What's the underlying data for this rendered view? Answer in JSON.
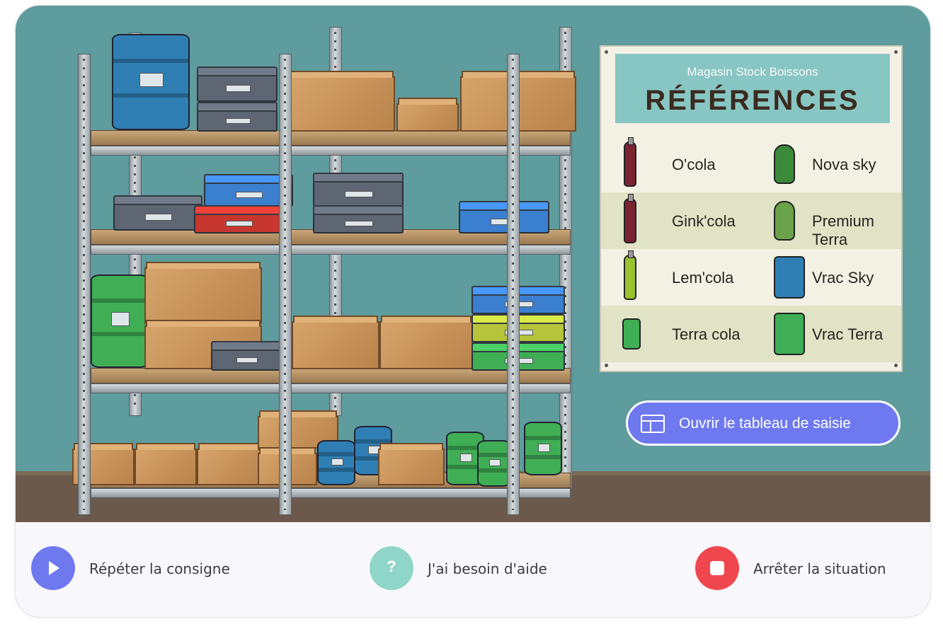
{
  "reference_board": {
    "subtitle": "Magasin Stock Boissons",
    "title": "RÉFÉRENCES",
    "items": [
      {
        "name": "O'cola",
        "icon": "red-bottle-icon"
      },
      {
        "name": "Nova sky",
        "icon": "orange-flask-bottle-icon"
      },
      {
        "name": "Gink'cola",
        "icon": "red-bottle-icon"
      },
      {
        "name": "Premium Terra",
        "icon": "green-flask-bottle-icon"
      },
      {
        "name": "Lem'cola",
        "icon": "yellow-bottle-icon"
      },
      {
        "name": "Vrac Sky",
        "icon": "blue-drum-icon"
      },
      {
        "name": "Terra cola",
        "icon": "green-can-icon"
      },
      {
        "name": "Vrac Terra",
        "icon": "green-drum-icon"
      }
    ]
  },
  "open_table_button": {
    "label": "Ouvrir le tableau de saisie",
    "icon": "table-icon"
  },
  "actions": {
    "repeat": {
      "label": "Répéter la consigne",
      "icon": "play-icon",
      "color": "#6e79f0"
    },
    "help": {
      "label": "J'ai besoin d'aide",
      "icon": "question-icon",
      "color": "#8fd6c8"
    },
    "stop": {
      "label": "Arrêter la situation",
      "icon": "stop-icon",
      "color": "#f0474f"
    }
  },
  "colors": {
    "wall": "#5e9c9d",
    "floor": "#6b5a4b",
    "accent": "#6e79f0"
  }
}
